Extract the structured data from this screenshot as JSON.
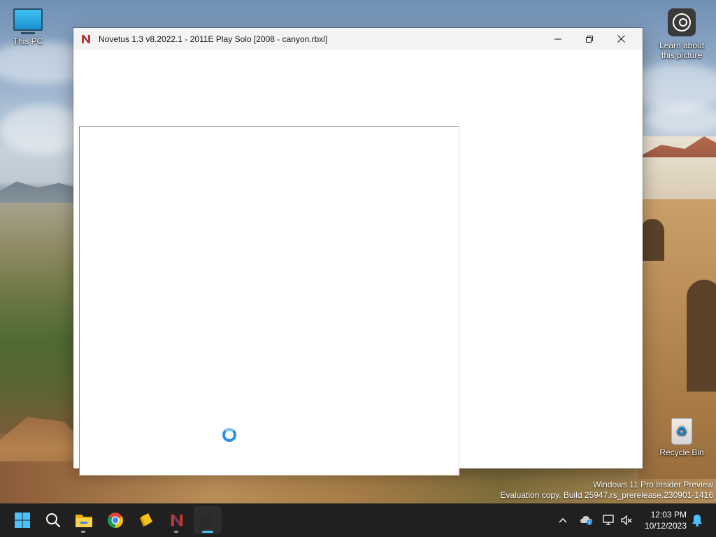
{
  "desktop": {
    "icons": [
      {
        "label": "This PC"
      },
      {
        "label": "Learn about this picture"
      },
      {
        "label": "Recycle Bin"
      }
    ],
    "watermark": {
      "line1": "Windows 11 Pro Insider Preview",
      "line2": "Evaluation copy. Build 25947.rs_prerelease.230901-1416"
    }
  },
  "window": {
    "title": "Novetus 1.3 v8.2022.1 - 2011E Play Solo [2008 - canyon.rbxl]",
    "app_icon": "novetus-n-icon",
    "controls": [
      "minimize-icon",
      "restore-icon",
      "close-icon"
    ],
    "status": "loading-spinner"
  },
  "taskbar": {
    "apps": [
      "windows-start-icon",
      "search-icon",
      "file-explorer-icon",
      "chrome-icon",
      "sticky-notes-icon",
      "novetus-icon",
      "active-window"
    ],
    "tray_icons": [
      "chevron-up-icon",
      "onedrive-icon",
      "display-network-icon",
      "volume-muted-icon",
      "notification-bell-icon"
    ],
    "time": "12:03 PM",
    "date": "10/12/2023"
  },
  "colors": {
    "taskbar_bg": "#202020",
    "titlebar_bg": "#f3f3f3",
    "accent": "#4cc2ff",
    "spinner": "#2b8fe0"
  }
}
